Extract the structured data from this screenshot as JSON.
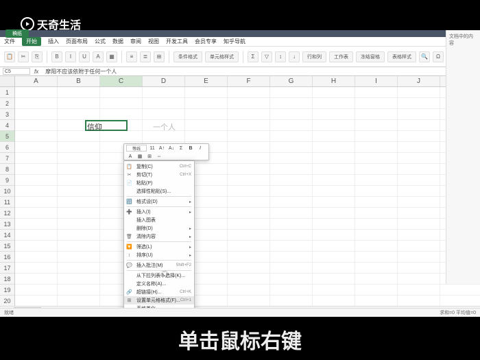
{
  "logo_text": "天奇生活",
  "title_tab": "稿纸",
  "menu": {
    "file": "文件",
    "start": "开始",
    "insert": "插入",
    "page": "页面布局",
    "formula": "公式",
    "data": "数据",
    "review": "审阅",
    "view": "视图",
    "dev": "开发工具",
    "member": "会员专享",
    "zhihu": "知乎导航"
  },
  "toolbar_groups": {
    "cond_fmt": "条件格式",
    "cell_style": "单元格样式",
    "sum": "求和",
    "filter": "筛选",
    "sort": "排序",
    "fill": "填充",
    "row_col": "行和列",
    "sheet": "工作表",
    "freeze": "冻结窗格",
    "table_style": "表格样式",
    "find": "查找",
    "symbol": "符号"
  },
  "cell_ref": "C5",
  "formula_bar_value": "摩阳不应该依附于任何一个人",
  "active_cell_display": "信仰",
  "active_cell_overflow": "一个人",
  "columns": [
    "A",
    "B",
    "C",
    "D",
    "E",
    "F",
    "G",
    "H",
    "I",
    "J"
  ],
  "rows": [
    1,
    2,
    3,
    4,
    5,
    6,
    7,
    8,
    9,
    10,
    11,
    12,
    13,
    14,
    15,
    16,
    17,
    18,
    19,
    20
  ],
  "mini_toolbar": {
    "font": "等线",
    "b": "B",
    "i": "I",
    "a": "A"
  },
  "context_menu": [
    {
      "icon": "📋",
      "label": "复制(C)",
      "shortcut": "Ctrl+C"
    },
    {
      "icon": "✂",
      "label": "剪切(T)",
      "shortcut": "Ctrl+X"
    },
    {
      "icon": "📄",
      "label": "粘贴(P)",
      "shortcut": ""
    },
    {
      "icon": "",
      "label": "选择性粘贴(S)...",
      "shortcut": ""
    },
    {
      "sep": true
    },
    {
      "icon": "🔢",
      "label": "格式设(D)",
      "shortcut": "",
      "arrow": true
    },
    {
      "sep": true
    },
    {
      "icon": "➕",
      "label": "插入(I)",
      "shortcut": "",
      "arrow": true
    },
    {
      "icon": "",
      "label": "插入图表",
      "shortcut": ""
    },
    {
      "icon": "",
      "label": "删除(D)",
      "shortcut": "",
      "arrow": true
    },
    {
      "icon": "🗑",
      "label": "清除内容",
      "shortcut": "",
      "arrow": true
    },
    {
      "sep": true
    },
    {
      "icon": "🔽",
      "label": "筛选(L)",
      "shortcut": "",
      "arrow": true
    },
    {
      "icon": "↕",
      "label": "排序(U)",
      "shortcut": "",
      "arrow": true
    },
    {
      "sep": true
    },
    {
      "icon": "💬",
      "label": "插入批注(M)",
      "shortcut": "Shift+F2"
    },
    {
      "sep": true
    },
    {
      "icon": "",
      "label": "从下拉列表中选择(K)...",
      "shortcut": ""
    },
    {
      "icon": "",
      "label": "定义名称(A)...",
      "shortcut": ""
    },
    {
      "icon": "🔗",
      "label": "超链接(H)...",
      "shortcut": "Ctrl+K"
    },
    {
      "icon": "⊞",
      "label": "设置单元格格式(F)...",
      "shortcut": "Ctrl+1",
      "hover": true
    },
    {
      "icon": "",
      "label": "表格美化...",
      "shortcut": ""
    }
  ],
  "right_panel_title": "文档中的内容",
  "sheet_tab": "Sheet1",
  "status_left": "就绪",
  "status_right": "求和=0 平均值=0",
  "subtitle": "单击鼠标右键"
}
